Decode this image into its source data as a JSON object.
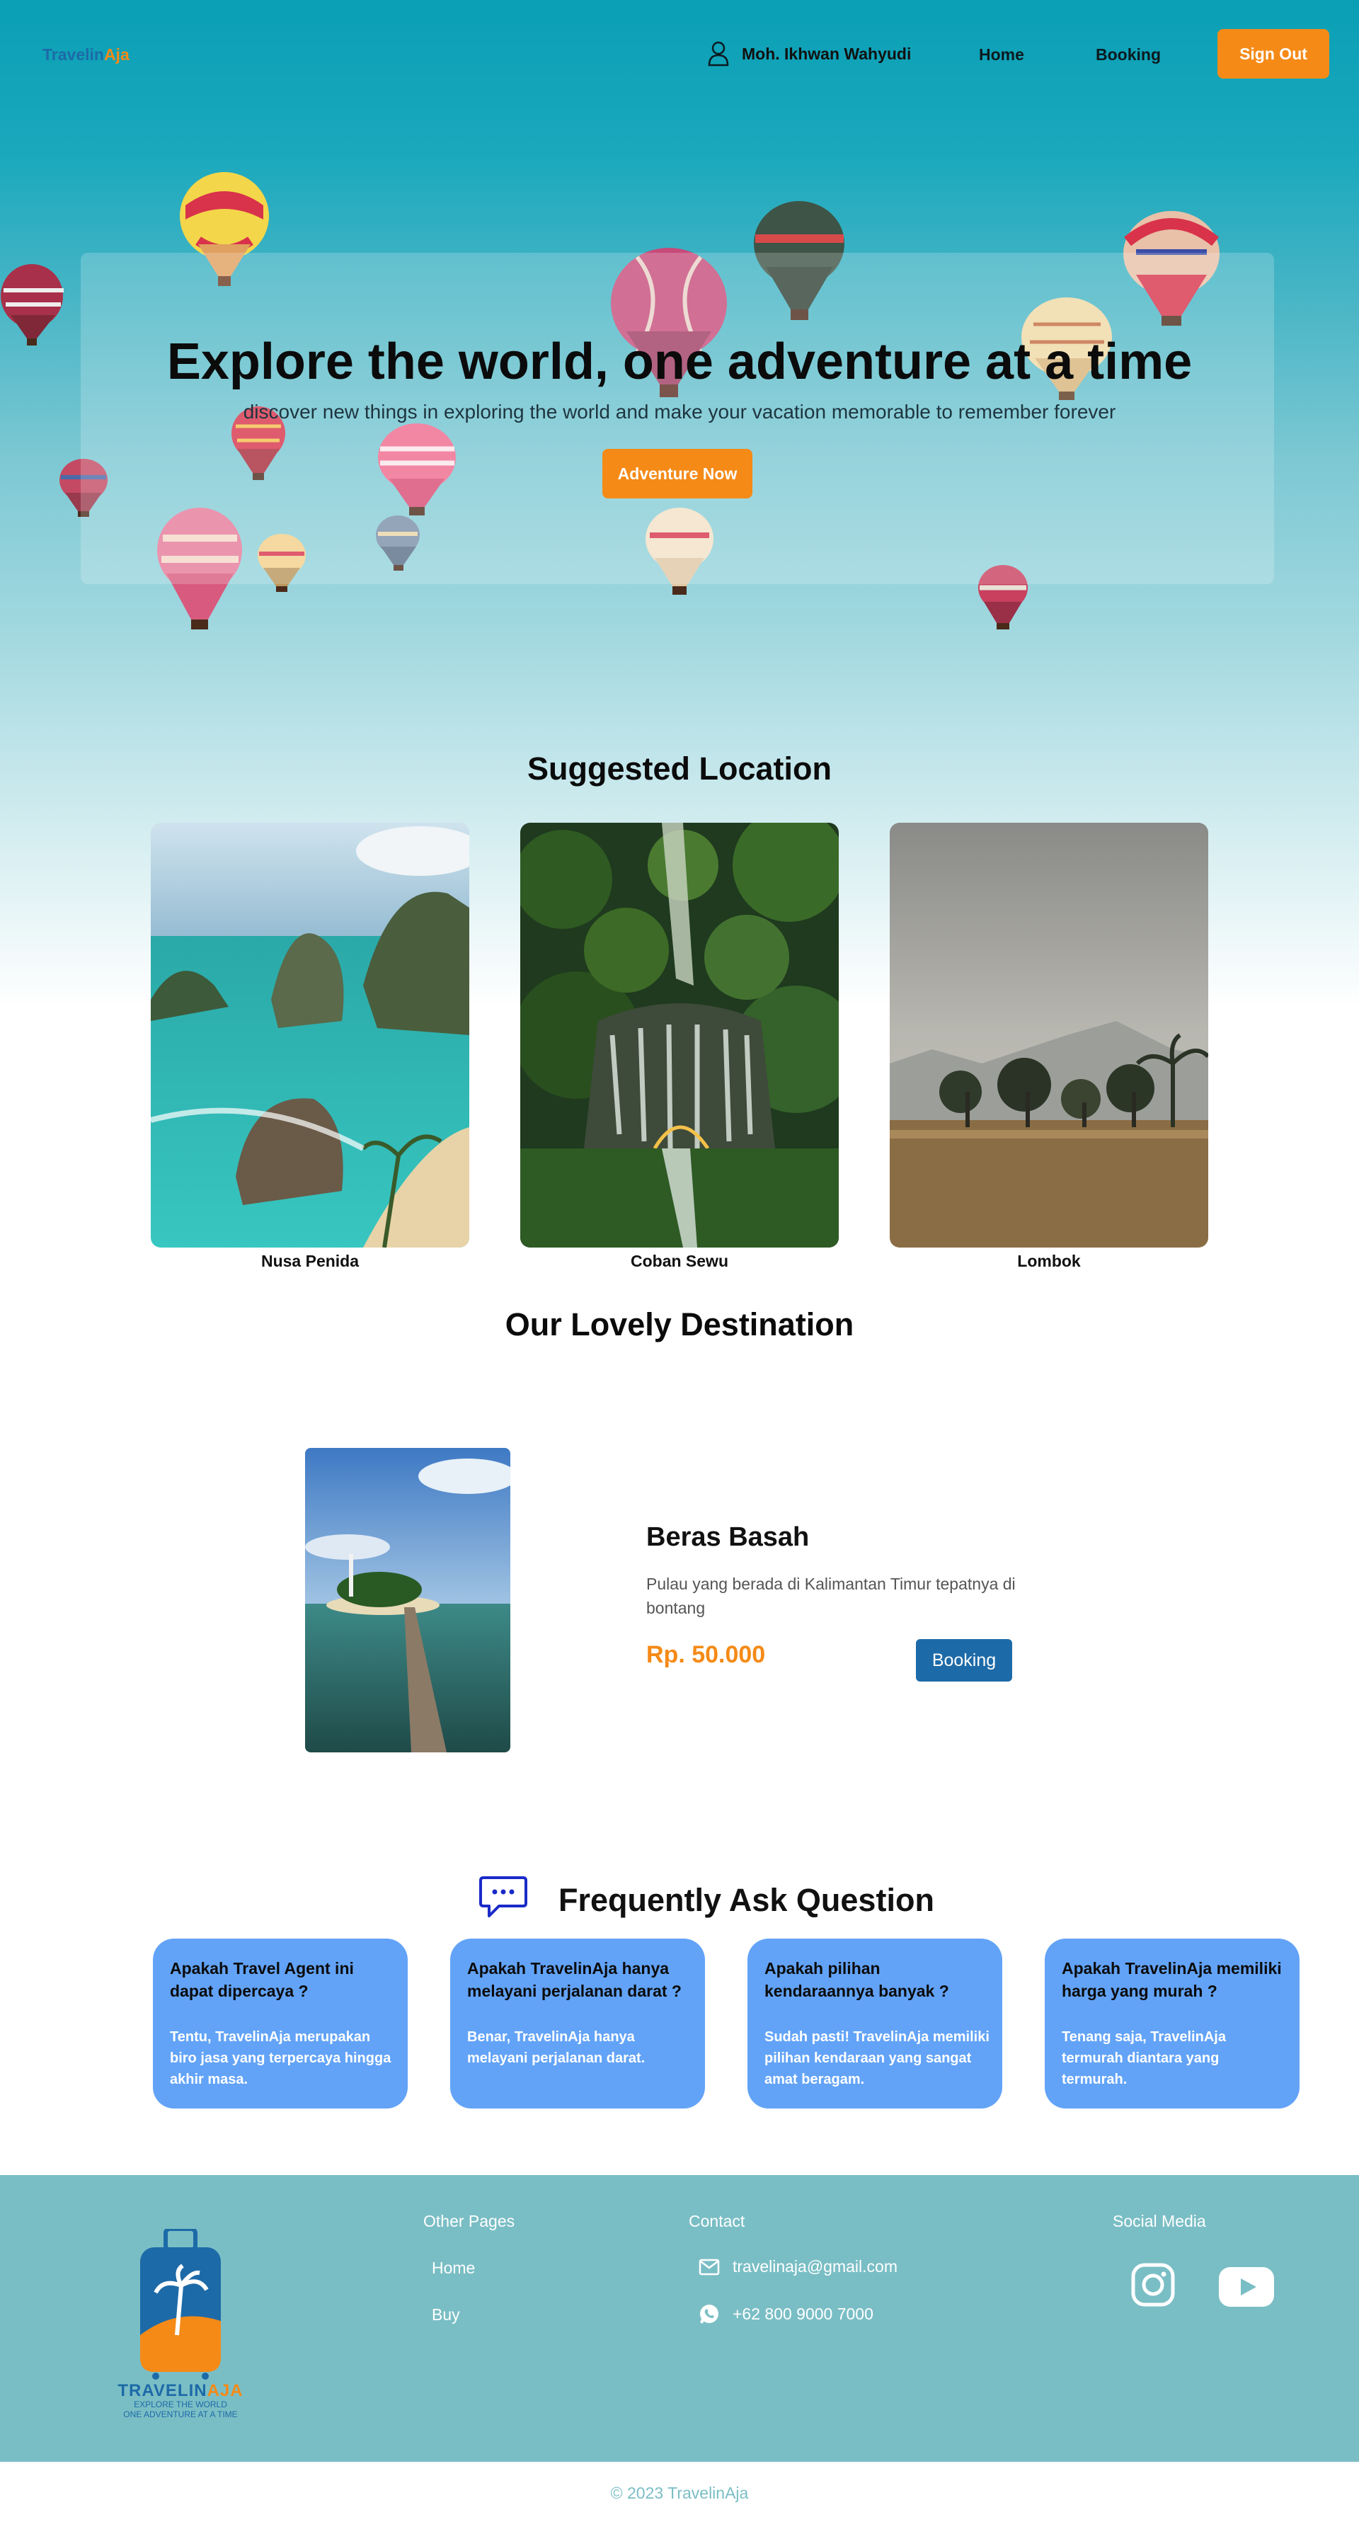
{
  "brand": {
    "part1": "Travelin",
    "part2": "Aja"
  },
  "nav": {
    "user_name": "Moh. Ikhwan Wahyudi",
    "home": "Home",
    "booking": "Booking",
    "sign_out": "Sign Out"
  },
  "hero": {
    "title": "Explore the world, one adventure at a time",
    "subtitle": "discover new things in exploring the world and make your vacation memorable to remember forever",
    "button": "Adventure Now"
  },
  "suggested": {
    "title": "Suggested Location",
    "items": [
      {
        "label": "Nusa Penida"
      },
      {
        "label": "Coban Sewu"
      },
      {
        "label": "Lombok"
      }
    ]
  },
  "destination": {
    "title": "Our Lovely Destination",
    "name": "Beras Basah",
    "description": "Pulau yang berada di Kalimantan Timur tepatnya di bontang",
    "price": "Rp. 50.000",
    "button": "Booking"
  },
  "faq": {
    "title": "Frequently Ask Question",
    "items": [
      {
        "q": "Apakah Travel Agent ini dapat dipercaya ?",
        "a": "Tentu, TravelinAja merupakan biro jasa yang terpercaya hingga akhir masa."
      },
      {
        "q": "Apakah TravelinAja hanya melayani perjalanan darat ?",
        "a": "Benar, TravelinAja hanya melayani perjalanan darat."
      },
      {
        "q": "Apakah pilihan kendaraannya banyak ?",
        "a": "Sudah pasti! TravelinAja memiliki pilihan kendaraan yang sangat amat beragam."
      },
      {
        "q": "Apakah TravelinAja memiliki harga yang murah ?",
        "a": "Tenang saja, TravelinAja termurah diantara yang termurah."
      }
    ]
  },
  "footer": {
    "logo": {
      "name1": "TRAVELIN",
      "name2": "AJA",
      "tag1": "EXPLORE THE WORLD",
      "tag2": "ONE ADVENTURE AT A TIME"
    },
    "other_pages": {
      "title": "Other Pages",
      "home": "Home",
      "buy": "Buy"
    },
    "contact": {
      "title": "Contact",
      "email": "travelinaja@gmail.com",
      "phone": "+62 800 9000 7000"
    },
    "social": {
      "title": "Social Media",
      "icons": [
        "instagram-icon",
        "youtube-icon"
      ]
    },
    "copyright": "© 2023 TravelinAja"
  },
  "colors": {
    "accent": "#f58a17",
    "brand_blue": "#1d6aa8",
    "faq_card": "#62a3f7",
    "footer": "#7abec5"
  }
}
